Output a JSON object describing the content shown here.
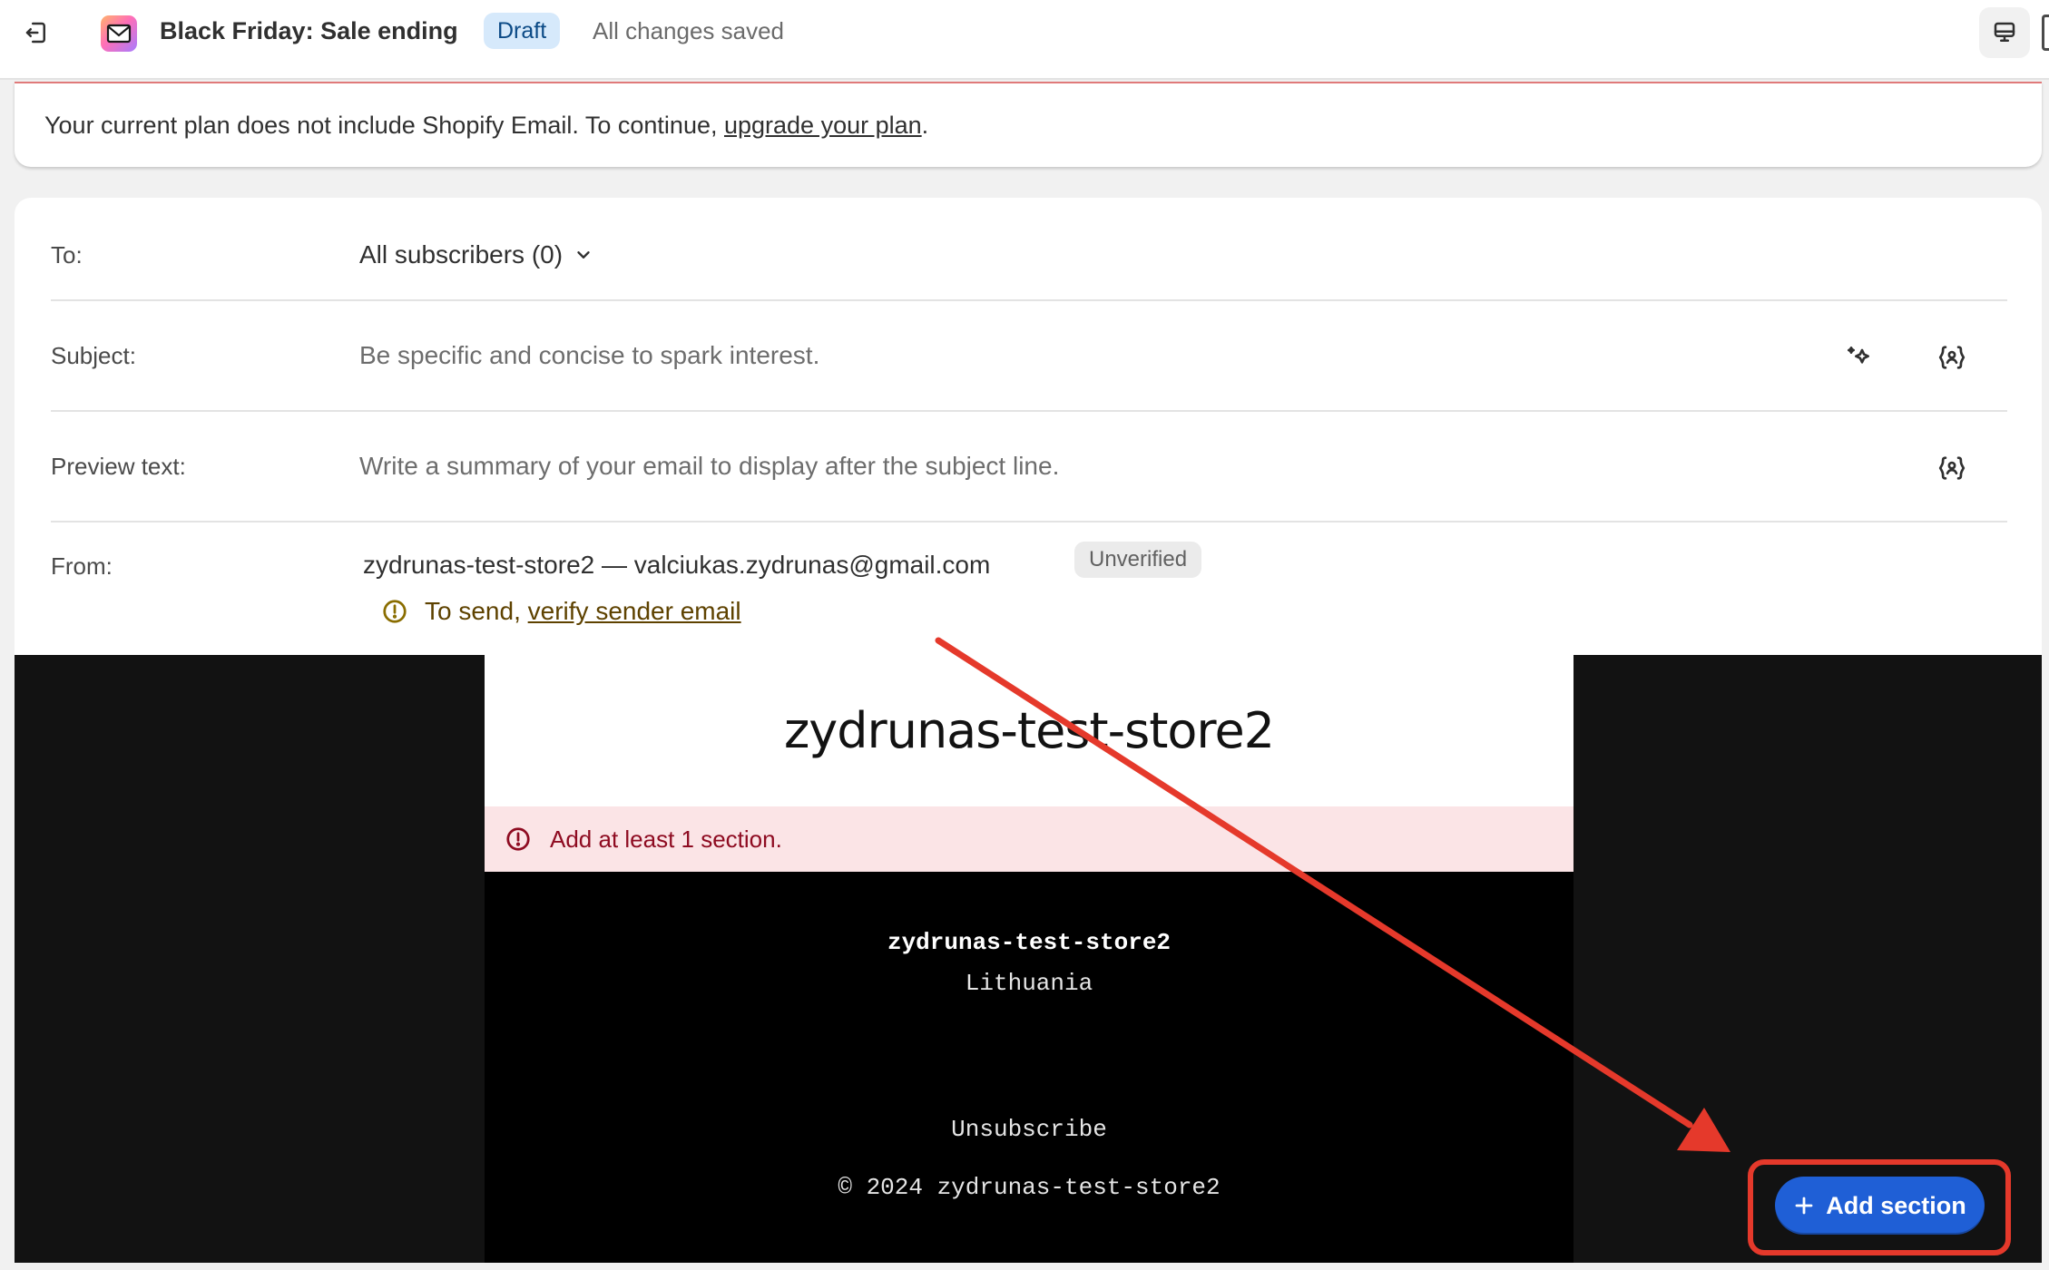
{
  "topbar": {
    "title": "Black Friday: Sale ending",
    "status_badge": "Draft",
    "save_status": "All changes saved"
  },
  "banner": {
    "text_before": "Your current plan does not include Shopify Email. To continue, ",
    "link": "upgrade your plan",
    "text_after": "."
  },
  "form": {
    "to": {
      "label": "To:",
      "value": "All subscribers (0)"
    },
    "subject": {
      "label": "Subject:",
      "placeholder": "Be specific and concise to spark interest."
    },
    "preview_text": {
      "label": "Preview text:",
      "placeholder": "Write a summary of your email to display after the subject line."
    },
    "from": {
      "label": "From:",
      "value": "zydrunas-test-store2 — valciukas.zydrunas@gmail.com",
      "badge": "Unverified",
      "warning_prefix": "To send, ",
      "warning_link": "verify sender email"
    }
  },
  "preview": {
    "header_store_name": "zydrunas-test-store2",
    "error": "Add at least 1 section.",
    "footer_store_name": "zydrunas-test-store2",
    "footer_country": "Lithuania",
    "unsubscribe": "Unsubscribe",
    "copyright": "© 2024 zydrunas-test-store2"
  },
  "actions": {
    "add_section": "Add section"
  },
  "colors": {
    "accent_button": "#1f5fd6",
    "annotation": "#e5392b",
    "error_bg": "#fbe4e6",
    "draft_badge_bg": "#d6e9fb"
  },
  "icons": [
    "exit-icon",
    "email-app-icon",
    "desktop-icon",
    "chevron-down-icon",
    "sparkle-icon",
    "personalize-icon",
    "warning-circle-icon",
    "error-circle-icon",
    "plus-icon"
  ]
}
